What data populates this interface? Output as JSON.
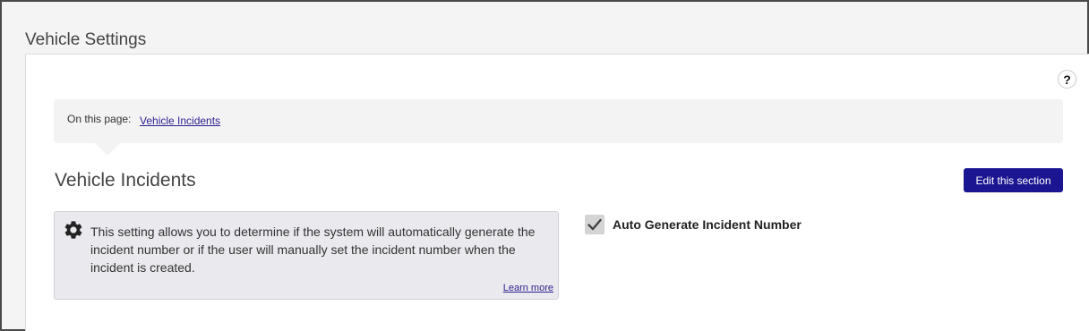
{
  "page": {
    "title": "Vehicle Settings"
  },
  "help": {
    "label": "?"
  },
  "on_this_page": {
    "label": "On this page:",
    "links": [
      "Vehicle Incidents"
    ]
  },
  "section": {
    "title": "Vehicle Incidents",
    "edit_label": "Edit this section",
    "info_text": "This setting allows you to determine if the system will automatically generate the incident number or if the user will manually set the incident number when the incident is created.",
    "learn_more": "Learn more",
    "setting_label": "Auto Generate Incident Number",
    "setting_checked": true
  },
  "colors": {
    "accent": "#1c1591",
    "link": "#2b1f8f"
  },
  "icons": {
    "help": "question-icon",
    "info": "gear-icon",
    "check": "checkmark-icon"
  }
}
